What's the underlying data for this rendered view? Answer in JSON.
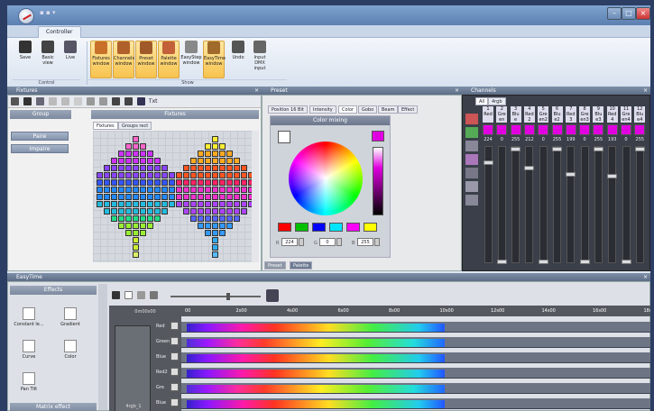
{
  "window": {
    "qat": "▪ ▪ ▾"
  },
  "tabs": {
    "controller": "Controller"
  },
  "ribbon": {
    "buttons": [
      {
        "label": "Save",
        "icon": "save-icon",
        "on": false
      },
      {
        "label": "Basic view",
        "icon": "basic-view-icon",
        "on": false
      },
      {
        "label": "Live",
        "icon": "live-icon",
        "on": false
      },
      {
        "label": "Fixtures window",
        "icon": "fixtures-window-icon",
        "on": true
      },
      {
        "label": "Channels window",
        "icon": "channels-window-icon",
        "on": true
      },
      {
        "label": "Preset window",
        "icon": "preset-window-icon",
        "on": true
      },
      {
        "label": "Palette window",
        "icon": "palette-window-icon",
        "on": true
      },
      {
        "label": "EasyStep window",
        "icon": "easystep-window-icon",
        "on": false
      },
      {
        "label": "EasyTime window",
        "icon": "easytime-window-icon",
        "on": true
      },
      {
        "label": "Undo",
        "icon": "undo-icon",
        "on": false
      },
      {
        "label": "Input DMX input",
        "icon": "dmx-input-icon",
        "on": false
      }
    ],
    "groups": {
      "control": "Control",
      "show": "Show"
    }
  },
  "fixtures": {
    "title": "Fixtures",
    "group_header": "Group",
    "fixtures_header": "Fixtures",
    "groups": [
      "Paire",
      "Impaire"
    ],
    "subtabs": [
      "Fixtures",
      "Groups rect"
    ],
    "txt_label": "Txt"
  },
  "preset": {
    "title": "Preset",
    "tabs": [
      "Position 16 Bit",
      "Intensity",
      "Color",
      "Gobo",
      "Beam",
      "Effect"
    ],
    "active_tab": "Color",
    "color_mixing": "Color mixing",
    "swatches": [
      "#ff0000",
      "#00c000",
      "#0000ff",
      "#00e5ff",
      "#ff00ff",
      "#ffff00"
    ],
    "selected_color": "#e000e0",
    "r": {
      "label": "R",
      "value": "224"
    },
    "g": {
      "label": "G",
      "value": "0"
    },
    "b": {
      "label": "B",
      "value": "255"
    },
    "bottom_tabs": [
      "Preset",
      "Palette"
    ]
  },
  "channels": {
    "title": "Channels",
    "tabs": [
      "All",
      "4rgb"
    ],
    "numbers": [
      "1",
      "2",
      "3",
      "4",
      "5",
      "6",
      "7",
      "8",
      "9",
      "10",
      "11",
      "12"
    ],
    "names": [
      "Red",
      "Gre en",
      "Blu e",
      "Red 2",
      "Gre en2",
      "Blu e2",
      "Red 3",
      "Gre en3",
      "Blu e3",
      "Red 4",
      "Gre en4",
      "Blu e4"
    ],
    "values": [
      "224",
      "0",
      "255",
      "212",
      "0",
      "255",
      "199",
      "0",
      "255",
      "193",
      "0",
      "255"
    ],
    "levels": [
      0.88,
      0,
      1,
      0.83,
      0,
      1,
      0.78,
      0,
      1,
      0.76,
      0,
      1
    ]
  },
  "easytime": {
    "title": "EasyTime",
    "effects_header": "Effects",
    "effects": [
      "Constant le...",
      "Gradient",
      "Curve",
      "Color",
      "Pan Tilt"
    ],
    "matrix_header": "Matrix effect",
    "time_start": "0m00s00",
    "ruler": [
      "00",
      "2s00",
      "4s00",
      "6s00",
      "8s00",
      "10s00",
      "12s00",
      "14s00",
      "16s00",
      "18s00"
    ],
    "tracks": [
      "Red",
      "Green",
      "Blue",
      "Red2",
      "Gre",
      "Blue"
    ],
    "group_label": "4rgb_1"
  }
}
